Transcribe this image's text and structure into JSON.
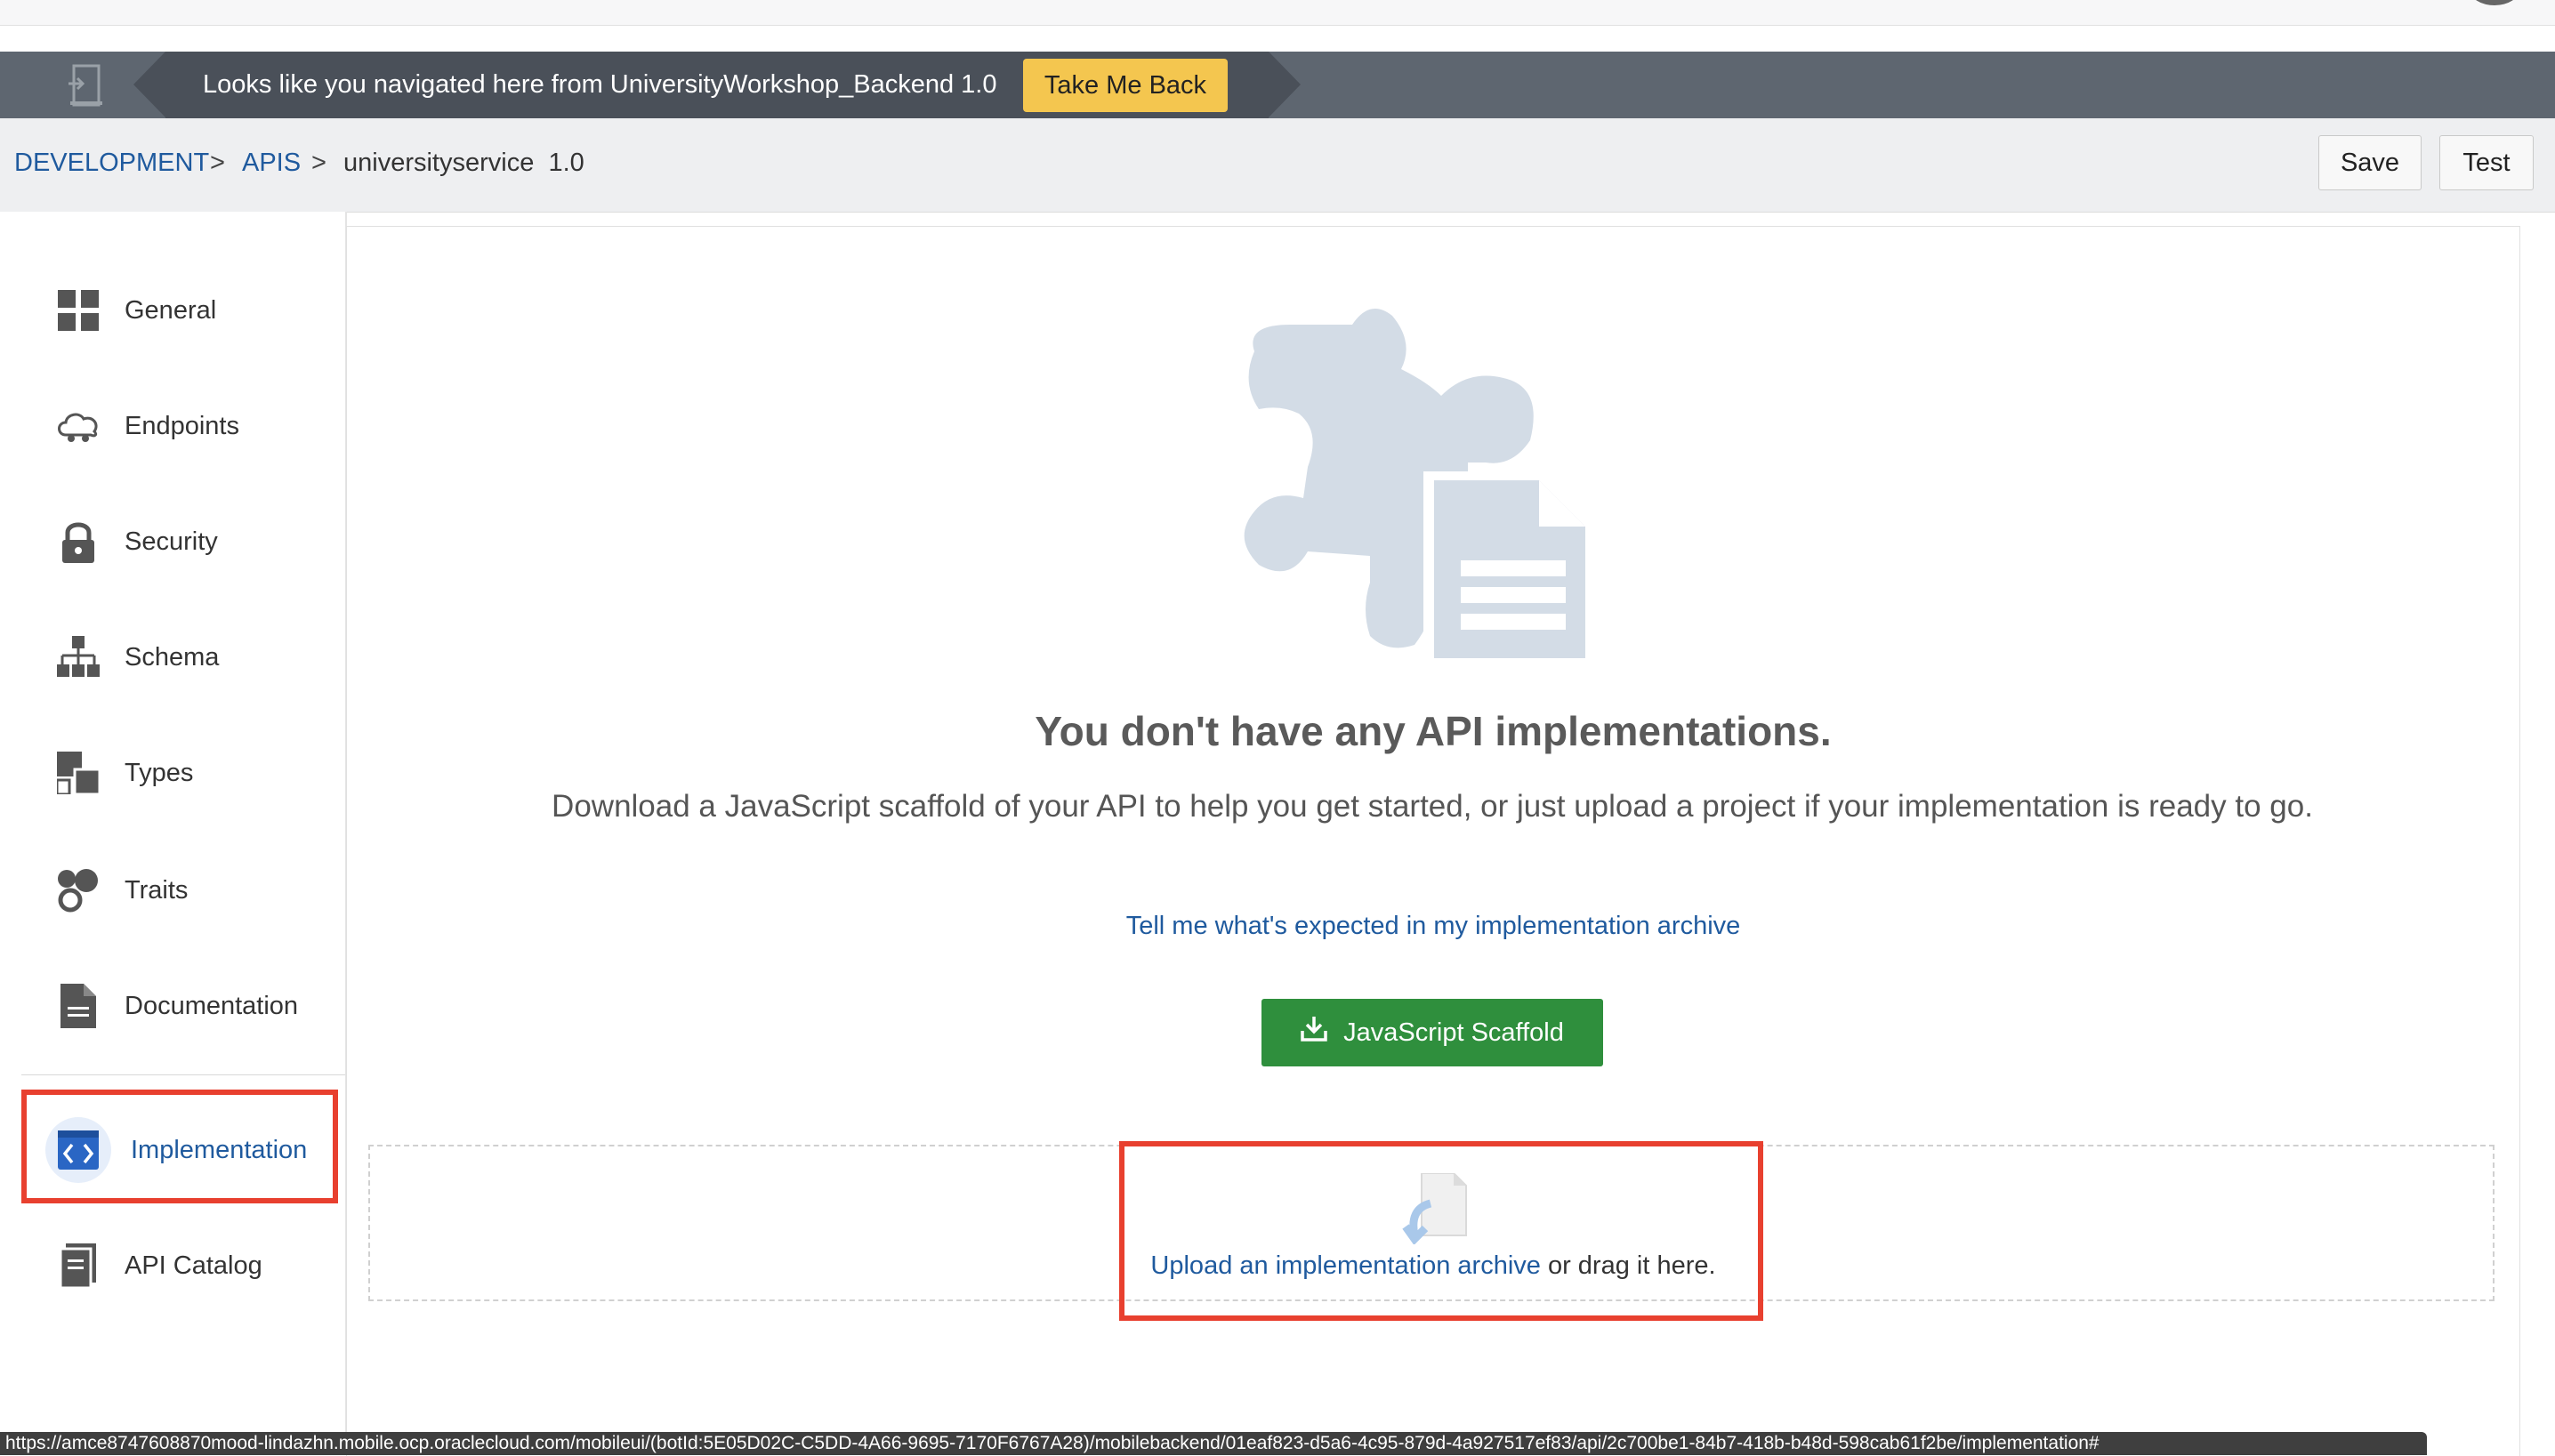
{
  "banner": {
    "message": "Looks like you navigated here from UniversityWorkshop_Backend 1.0",
    "take_me_back_label": "Take Me Back",
    "icon": "exit-door-icon"
  },
  "breadcrumb": {
    "development": "DEVELOPMENT",
    "sep": ">",
    "apis": "APIS",
    "current": "universityservice  1.0"
  },
  "toolbar": {
    "save_label": "Save",
    "test_label": "Test"
  },
  "sidebar": {
    "items": [
      {
        "label": "General",
        "icon": "grid-icon"
      },
      {
        "label": "Endpoints",
        "icon": "cloud-icon"
      },
      {
        "label": "Security",
        "icon": "lock-icon"
      },
      {
        "label": "Schema",
        "icon": "hierarchy-icon"
      },
      {
        "label": "Types",
        "icon": "types-icon"
      },
      {
        "label": "Traits",
        "icon": "traits-icon"
      },
      {
        "label": "Documentation",
        "icon": "document-icon"
      },
      {
        "label": "Implementation",
        "icon": "code-icon",
        "active": true
      },
      {
        "label": "API Catalog",
        "icon": "catalog-icon"
      }
    ]
  },
  "main": {
    "heading": "You don't have any API implementations.",
    "description": "Download a JavaScript scaffold of your API to help you get started, or just upload a project if your implementation is ready to go.",
    "tell_me_link": "Tell me what's expected in my implementation archive",
    "scaffold_button": "JavaScript Scaffold",
    "upload_link": "Upload an implementation archive",
    "upload_suffix": " or drag it here."
  },
  "status_url": "https://amce8747608870mood-lindazhn.mobile.ocp.oraclecloud.com/mobileui/(botId:5E05D02C-C5DD-4A66-9695-7170F6767A28)/mobilebackend/01eaf823-d5a6-4c95-879d-4a927517ef83/api/2c700be1-84b7-418b-b48d-598cab61f2be/implementation#",
  "colors": {
    "accent": "#1f5a9e",
    "banner": "#5e6670",
    "take_me_back": "#f4c64f",
    "scaffold_green": "#2f8f3d",
    "highlight_red": "#e8402f"
  }
}
